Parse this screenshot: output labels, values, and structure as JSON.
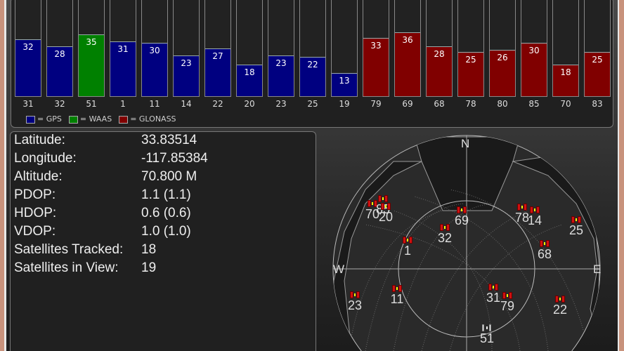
{
  "snr_chart": {
    "type": "bar",
    "max": 55,
    "bars": [
      {
        "prn": "31",
        "snr": 32,
        "system": "gps"
      },
      {
        "prn": "32",
        "snr": 28,
        "system": "gps"
      },
      {
        "prn": "51",
        "snr": 35,
        "system": "waas"
      },
      {
        "prn": "1",
        "snr": 31,
        "system": "gps"
      },
      {
        "prn": "11",
        "snr": 30,
        "system": "gps"
      },
      {
        "prn": "14",
        "snr": 23,
        "system": "gps"
      },
      {
        "prn": "22",
        "snr": 27,
        "system": "gps"
      },
      {
        "prn": "20",
        "snr": 18,
        "system": "gps"
      },
      {
        "prn": "23",
        "snr": 23,
        "system": "gps"
      },
      {
        "prn": "25",
        "snr": 22,
        "system": "gps"
      },
      {
        "prn": "19",
        "snr": 13,
        "system": "gps"
      },
      {
        "prn": "79",
        "snr": 33,
        "system": "glonass"
      },
      {
        "prn": "69",
        "snr": 36,
        "system": "glonass"
      },
      {
        "prn": "68",
        "snr": 28,
        "system": "glonass"
      },
      {
        "prn": "78",
        "snr": 25,
        "system": "glonass"
      },
      {
        "prn": "80",
        "snr": 26,
        "system": "glonass"
      },
      {
        "prn": "85",
        "snr": 30,
        "system": "glonass"
      },
      {
        "prn": "70",
        "snr": 18,
        "system": "glonass"
      },
      {
        "prn": "83",
        "snr": 25,
        "system": "glonass"
      }
    ],
    "colors": {
      "gps": "#000080",
      "waas": "#008000",
      "glonass": "#800000"
    },
    "legend": {
      "gps": "= GPS",
      "waas": "= WAAS",
      "glonass": "= GLONASS"
    }
  },
  "info": [
    {
      "label": "Latitude:",
      "value": "33.83514"
    },
    {
      "label": "Longitude:",
      "value": "-117.85384"
    },
    {
      "label": "Altitude:",
      "value": "70.800 M"
    },
    {
      "label": "PDOP:",
      "value": "1.1 (1.1)"
    },
    {
      "label": "HDOP:",
      "value": "0.6 (0.6)"
    },
    {
      "label": "VDOP:",
      "value": "1.0 (1.0)"
    },
    {
      "label": "Satellites Tracked:",
      "value": "18"
    },
    {
      "label": "Satellites in View:",
      "value": "19"
    }
  ],
  "skyplot": {
    "directions": {
      "n": "N",
      "e": "E",
      "w": "W"
    },
    "satellites": [
      "70",
      "85",
      "20",
      "69",
      "32",
      "1",
      "78",
      "14",
      "25",
      "68",
      "23",
      "11",
      "31",
      "79",
      "22",
      "51"
    ]
  }
}
